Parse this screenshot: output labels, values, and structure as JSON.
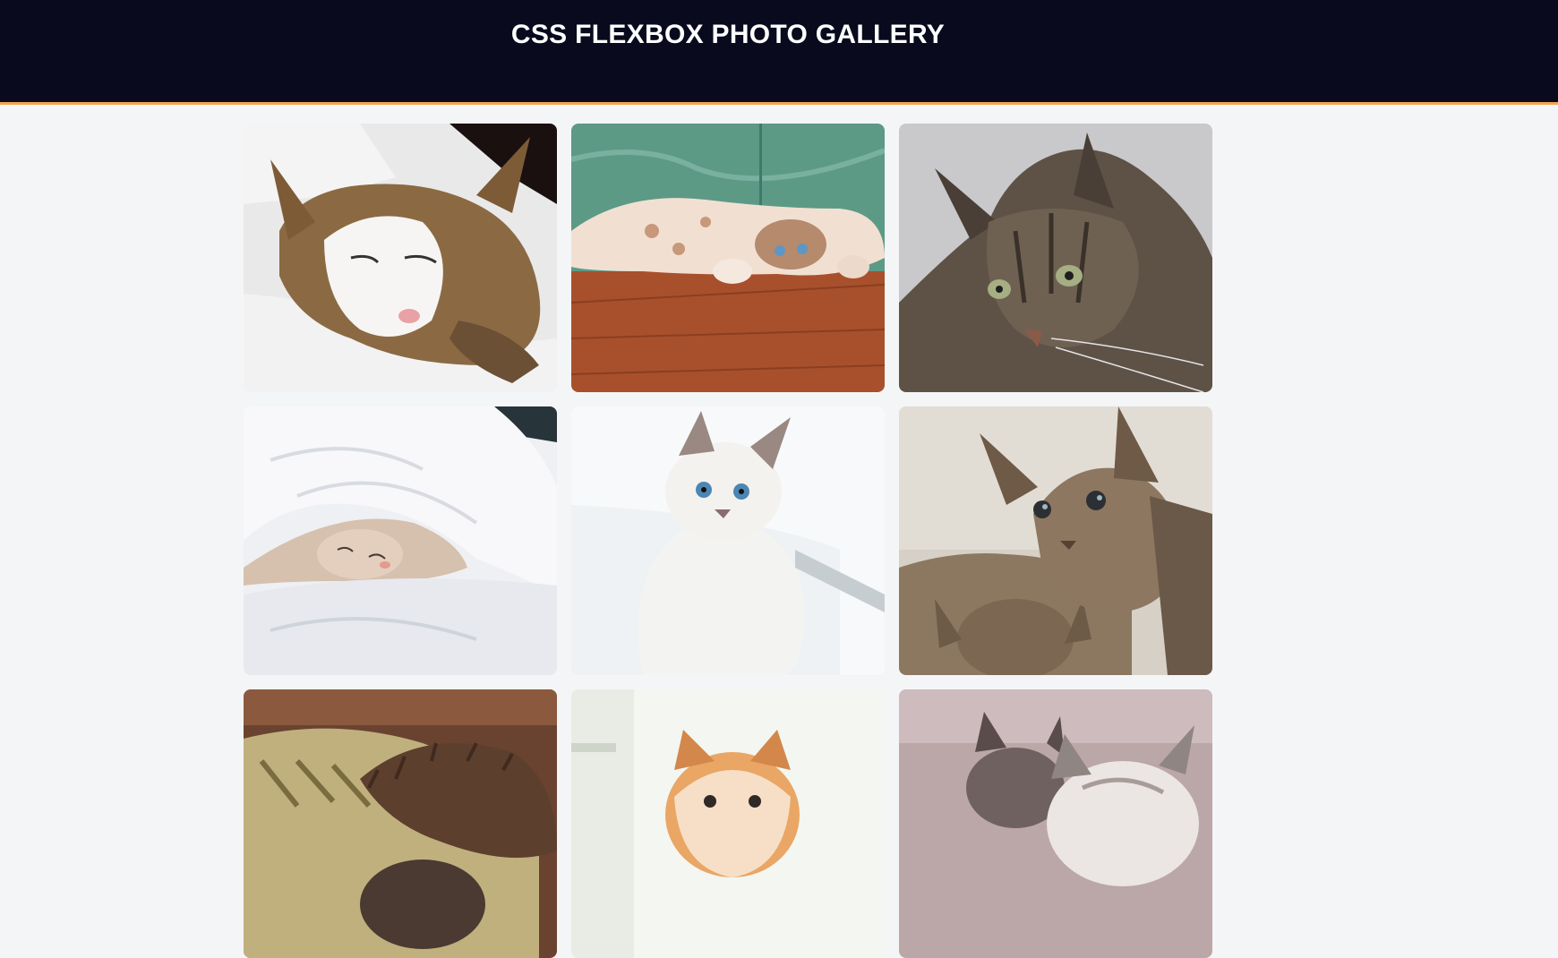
{
  "header": {
    "title": "CSS FLEXBOX PHOTO GALLERY"
  },
  "gallery": {
    "photos": [
      {
        "subject": "sleeping tabby-and-white cat on bedsheets"
      },
      {
        "subject": "cream cat lying on its back on a wooden floor"
      },
      {
        "subject": "long-haired tabby cat portrait"
      },
      {
        "subject": "kitten sleeping under a white duvet"
      },
      {
        "subject": "white blue-eyed kitten by a window"
      },
      {
        "subject": "two tabby kittens"
      },
      {
        "subject": "cat hidden under a brown cushion"
      },
      {
        "subject": "orange and white kitten"
      },
      {
        "subject": "two kittens, grey and white"
      }
    ]
  }
}
